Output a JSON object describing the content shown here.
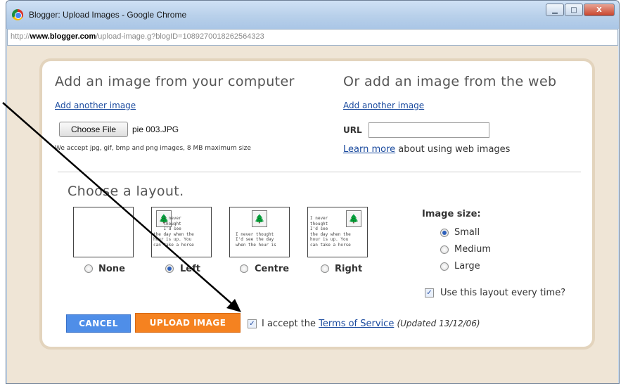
{
  "window": {
    "title": "Blogger: Upload Images - Google Chrome",
    "url_prefix": "http://",
    "url_domain": "www.blogger.com",
    "url_path": "/upload-image.g?blogID=1089270018262564323",
    "minimize": "▁",
    "maximize": "□",
    "close": "X"
  },
  "computer": {
    "heading": "Add an image from your computer",
    "add_another": "Add another image",
    "choose_file": "Choose File",
    "filename": "pie 003.JPG",
    "accepted_note": "We accept jpg, gif, bmp and png images, 8 MB maximum size"
  },
  "web": {
    "heading": "Or add an image from the web",
    "add_another": "Add another image",
    "url_label": "URL",
    "url_value": "",
    "learn_more": "Learn more",
    "learn_more_suffix": " about using web images"
  },
  "layout": {
    "heading": "Choose a layout.",
    "thumb_text_left": "    I never\n    thought\n    I'd see\nthe day when the\nhour is up. You\ncan take a horse",
    "thumb_text_centre": "\n\n\nI never thought\nI'd see the day\nwhen the hour is",
    "thumb_text_right": "I never\nthought\nI'd see\nthe day when the\nhour is up. You\ncan take a horse",
    "options": [
      {
        "label": "None",
        "checked": false
      },
      {
        "label": "Left",
        "checked": true
      },
      {
        "label": "Centre",
        "checked": false
      },
      {
        "label": "Right",
        "checked": false
      }
    ]
  },
  "size": {
    "heading": "Image size:",
    "options": [
      {
        "label": "Small",
        "checked": true
      },
      {
        "label": "Medium",
        "checked": false
      },
      {
        "label": "Large",
        "checked": false
      }
    ],
    "use_every_time": "Use this layout every time?"
  },
  "actions": {
    "cancel": "CANCEL",
    "upload": "UPLOAD IMAGE",
    "accept_prefix": "I accept the ",
    "tos_link": "Terms of Service",
    "updated": "(Updated 13/12/06)",
    "check_glyph": "✓"
  },
  "colors": {
    "link": "#1a4a9e",
    "cancel_button": "#4f8ee8",
    "upload_button": "#f58220",
    "panel_border": "#e3d4bd",
    "page_bg": "#efe5d6"
  }
}
